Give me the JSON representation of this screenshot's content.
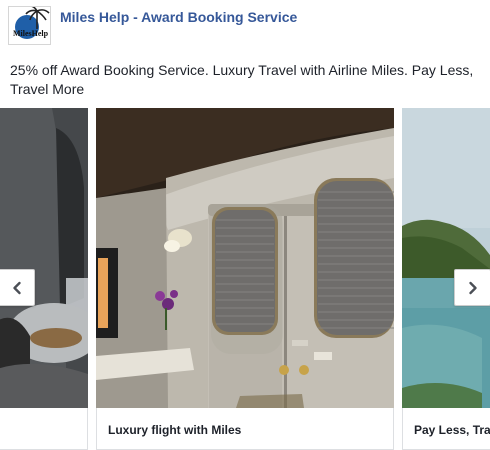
{
  "page": {
    "name": "Miles Help - Award Booking Service",
    "logo_text": "MilesHelp"
  },
  "post": {
    "text": "25% off Award Booking Service. Luxury Travel with Airline Miles. Pay Less, Travel More"
  },
  "carousel": {
    "cards": [
      {
        "title": ""
      },
      {
        "title": "Luxury flight with Miles"
      },
      {
        "title": "Pay Less, Travel More"
      }
    ]
  },
  "colors": {
    "page_name": "#365899",
    "text": "#1d2129",
    "border": "#dddfe2"
  },
  "icons": {
    "prev": "chevron-left-icon",
    "next": "chevron-right-icon"
  }
}
